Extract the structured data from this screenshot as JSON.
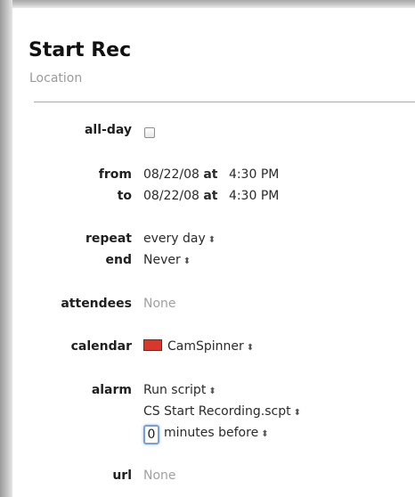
{
  "event": {
    "title": "Start Rec",
    "location_placeholder": "Location"
  },
  "fields": {
    "all_day": {
      "label": "all-day",
      "checked": false
    },
    "from": {
      "label": "from",
      "date": "08/22/08",
      "at": "at",
      "time": "4:30 PM"
    },
    "to": {
      "label": "to",
      "date": "08/22/08",
      "at": "at",
      "time": "4:30 PM"
    },
    "repeat": {
      "label": "repeat",
      "value": "every day"
    },
    "end": {
      "label": "end",
      "value": "Never"
    },
    "attendees": {
      "label": "attendees",
      "value": "None"
    },
    "calendar": {
      "label": "calendar",
      "value": "CamSpinner",
      "color": "#d8372e"
    },
    "alarm": {
      "label": "alarm",
      "action": "Run script",
      "script": "CS Start Recording.scpt",
      "minutes": "0",
      "minutes_suffix": "minutes before"
    },
    "url": {
      "label": "url",
      "value": "None"
    }
  },
  "icons": {
    "popup": "up-down-arrows-icon"
  }
}
